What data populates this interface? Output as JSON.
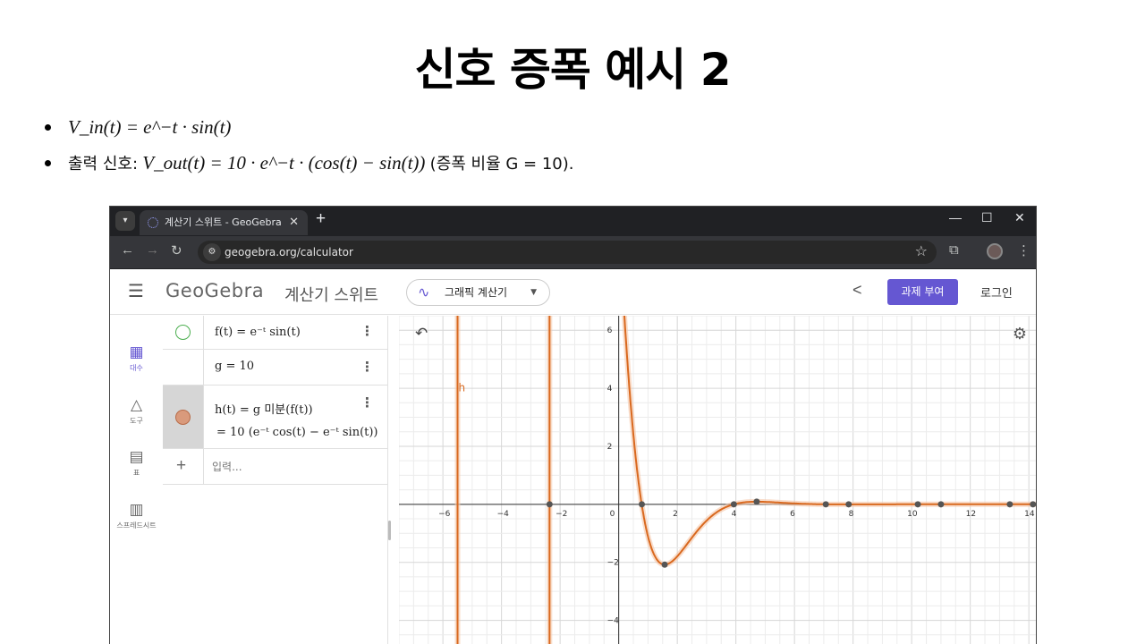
{
  "slide": {
    "title": "신호 증폭 예시 2",
    "bullet1": "V_in(t) = e^−t · sin(t)",
    "bullet2_prefix": "출력 신호:",
    "bullet2_formula": "V_out(t) = 10 · e^−t · (cos(t) − sin(t))",
    "bullet2_suffix": "(증폭 비율 G = 10)."
  },
  "browser": {
    "tab_title": "계산기 스위트 - GeoGebra",
    "url": "geogebra.org/calculator"
  },
  "geogebra": {
    "logo": "GeoGebra",
    "suite": "계산기 스위트",
    "app_selector": "그래픽 계산기",
    "assign_button": "과제 부여",
    "login": "로그인",
    "sidebar": [
      {
        "label": "대수",
        "icon": "calculator-icon"
      },
      {
        "label": "도구",
        "icon": "tools-icon"
      },
      {
        "label": "표",
        "icon": "table-icon"
      },
      {
        "label": "스프레드시트",
        "icon": "spreadsheet-icon"
      }
    ],
    "algebra": {
      "f_expr": "f(t) = e⁻ᵗ sin(t)",
      "g_expr": "g = 10",
      "h_expr": "h(t) = g 미분(f(t))",
      "h_result": "= 10 (e⁻ᵗ cos(t) − e⁻ᵗ sin(t))",
      "input_placeholder": "입력..."
    }
  },
  "chart_data": {
    "type": "line",
    "x_ticks": [
      -6,
      -4,
      -2,
      0,
      2,
      4,
      6,
      8,
      10,
      12,
      14
    ],
    "y_ticks": [
      6,
      4,
      2,
      -2,
      -4
    ],
    "xlim": [
      -7.5,
      14.3
    ],
    "ylim": [
      -5,
      6.5
    ],
    "grid": true,
    "series": [
      {
        "name": "h",
        "color": "#d9691f",
        "function": "10*exp(-t)*(cos(t)-sin(t))",
        "vertical_lines_x": [
          -5.5,
          -2.36
        ]
      }
    ],
    "points": [
      {
        "x": -2.36,
        "y": 0
      },
      {
        "x": 0.79,
        "y": 0
      },
      {
        "x": 1.57,
        "y": -2.08
      },
      {
        "x": 3.93,
        "y": 0
      },
      {
        "x": 4.71,
        "y": 0.09
      },
      {
        "x": 7.07,
        "y": 0
      },
      {
        "x": 7.85,
        "y": 0
      },
      {
        "x": 10.21,
        "y": 0
      },
      {
        "x": 11.0,
        "y": 0
      },
      {
        "x": 13.35,
        "y": 0
      },
      {
        "x": 14.14,
        "y": 0
      }
    ]
  }
}
